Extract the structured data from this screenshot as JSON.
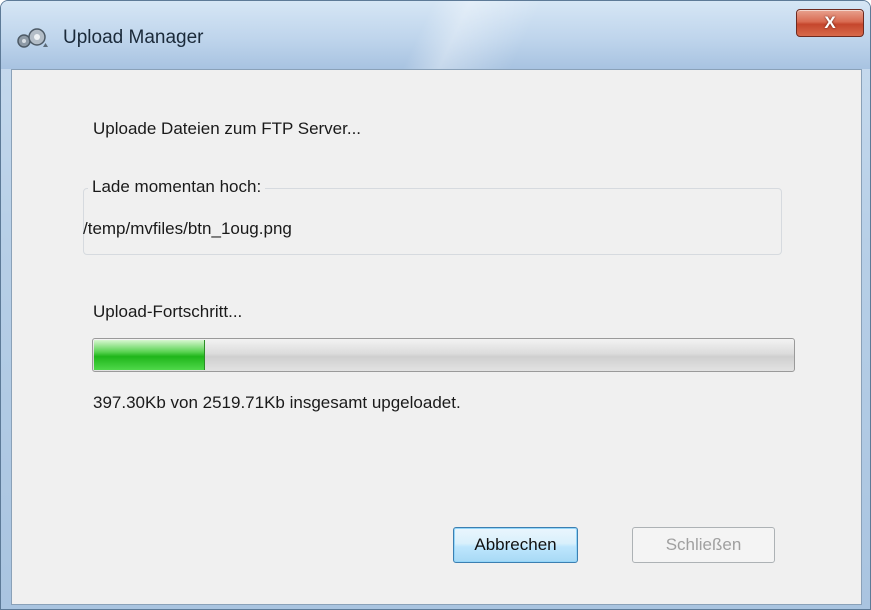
{
  "window": {
    "title": "Upload Manager",
    "close_glyph": "X",
    "icon": "upload-manager-icon"
  },
  "status": {
    "heading": "Uploade Dateien zum FTP Server..."
  },
  "current_file": {
    "group_label": "Lade momentan hoch:",
    "path": "/temp/mvfiles/btn_1oug.png"
  },
  "progress": {
    "label": "Upload-Fortschritt...",
    "uploaded_kb": 397.3,
    "total_kb": 2519.71,
    "fraction": 0.158,
    "summary": "397.30Kb von 2519.71Kb insgesamt upgeloadet."
  },
  "buttons": {
    "cancel_label": "Abbrechen",
    "close_label": "Schließen"
  },
  "colors": {
    "progress_green": "#1fb61a",
    "close_button_red": "#c5462d",
    "dialog_face": "#f0f0f0"
  }
}
